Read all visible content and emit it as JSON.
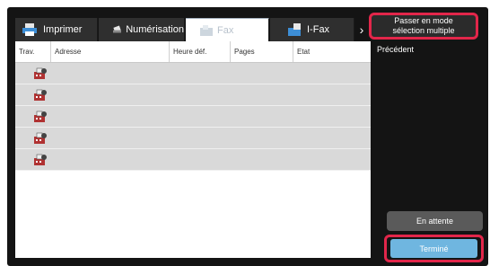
{
  "tabs": [
    {
      "label": "Imprimer",
      "icon": "printer-icon"
    },
    {
      "label": "Numérisation",
      "icon": "scanner-icon"
    },
    {
      "label": "Fax",
      "icon": "fax-icon"
    },
    {
      "label": "I-Fax",
      "icon": "ifax-icon"
    }
  ],
  "tab_more_glyph": "›",
  "active_tab": "Fax",
  "table": {
    "columns": [
      "Trav.",
      "Adresse",
      "Heure déf.",
      "Pages",
      "Etat"
    ],
    "row_icon": "fax-job-icon",
    "rows": 5
  },
  "side": {
    "mode_button": [
      "Passer en mode",
      "sélection multiple"
    ],
    "previous": "Précédent",
    "wait_button": "En attente",
    "done_button": "Terminé"
  },
  "colors": {
    "highlight": "#e2264a",
    "active_button": "#6fb6e0",
    "row_background": "#d9d9d9"
  }
}
